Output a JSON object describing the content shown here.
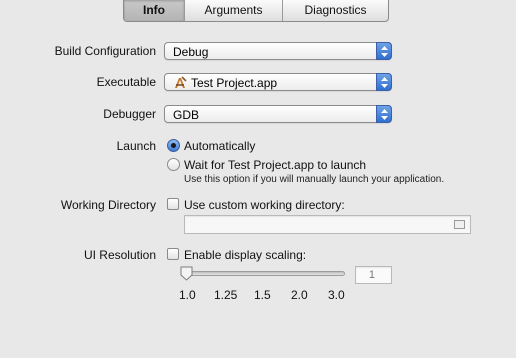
{
  "tabs": [
    {
      "label": "Info",
      "selected": true
    },
    {
      "label": "Arguments",
      "selected": false
    },
    {
      "label": "Diagnostics",
      "selected": false
    }
  ],
  "build_configuration": {
    "label": "Build Configuration",
    "value": "Debug"
  },
  "executable": {
    "label": "Executable",
    "value": "Test Project.app",
    "icon": "app-icon"
  },
  "debugger": {
    "label": "Debugger",
    "value": "GDB"
  },
  "launch": {
    "label": "Launch",
    "options": [
      {
        "label": "Automatically",
        "selected": true
      },
      {
        "label": "Wait for Test Project.app to launch",
        "selected": false
      }
    ],
    "note": "Use this option if you will manually launch your application."
  },
  "working_directory": {
    "label": "Working Directory",
    "checkbox_label": "Use custom working directory:",
    "checked": false,
    "path_value": ""
  },
  "ui_resolution": {
    "label": "UI Resolution",
    "checkbox_label": "Enable display scaling:",
    "checked": false,
    "value": "1",
    "slider_value": 1.0,
    "ticks": [
      "1.0",
      "1.25",
      "1.5",
      "2.0",
      "3.0"
    ]
  },
  "colors": {
    "background": "#e8e8e8",
    "accent": "#3d7cd6"
  }
}
